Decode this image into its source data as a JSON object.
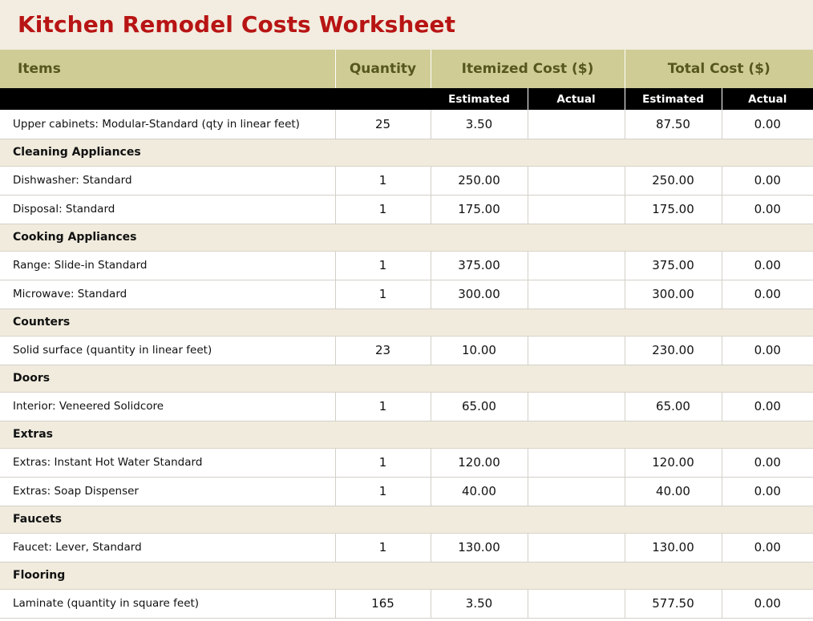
{
  "title": "Kitchen Remodel Costs Worksheet",
  "colors": {
    "title_text": "#b81414",
    "title_band": "#f2ede0",
    "group_header_bg": "#cfcd95",
    "group_header_text": "#56561f",
    "subheader_bg": "#000000",
    "subheader_text": "#ffffff",
    "category_row_bg": "#f0ebdd",
    "row_bg": "#ffffff",
    "grid_line": "#d4d0c8"
  },
  "header": {
    "items": "Items",
    "quantity": "Quantity",
    "itemized_cost": "Itemized Cost ($)",
    "total_cost": "Total Cost ($)"
  },
  "subheader": {
    "blank_items": "",
    "blank_quantity": "",
    "itemized_estimated": "Estimated",
    "itemized_actual": "Actual",
    "total_estimated": "Estimated",
    "total_actual": "Actual"
  },
  "rows": [
    {
      "kind": "item",
      "item": "Upper cabinets: Modular-Standard (qty in linear feet)",
      "quantity": "25",
      "itemized_estimated": "3.50",
      "itemized_actual": "",
      "total_estimated": "87.50",
      "total_actual": "0.00"
    },
    {
      "kind": "category",
      "item": "Cleaning Appliances"
    },
    {
      "kind": "item",
      "item": "Dishwasher: Standard",
      "quantity": "1",
      "itemized_estimated": "250.00",
      "itemized_actual": "",
      "total_estimated": "250.00",
      "total_actual": "0.00"
    },
    {
      "kind": "item",
      "item": "Disposal: Standard",
      "quantity": "1",
      "itemized_estimated": "175.00",
      "itemized_actual": "",
      "total_estimated": "175.00",
      "total_actual": "0.00"
    },
    {
      "kind": "category",
      "item": "Cooking Appliances"
    },
    {
      "kind": "item",
      "item": "Range: Slide-in Standard",
      "quantity": "1",
      "itemized_estimated": "375.00",
      "itemized_actual": "",
      "total_estimated": "375.00",
      "total_actual": "0.00"
    },
    {
      "kind": "item",
      "item": "Microwave: Standard",
      "quantity": "1",
      "itemized_estimated": "300.00",
      "itemized_actual": "",
      "total_estimated": "300.00",
      "total_actual": "0.00"
    },
    {
      "kind": "category",
      "item": "Counters"
    },
    {
      "kind": "item",
      "item": "Solid surface (quantity in linear feet)",
      "quantity": "23",
      "itemized_estimated": "10.00",
      "itemized_actual": "",
      "total_estimated": "230.00",
      "total_actual": "0.00"
    },
    {
      "kind": "category",
      "item": "Doors"
    },
    {
      "kind": "item",
      "item": "Interior: Veneered Solidcore",
      "quantity": "1",
      "itemized_estimated": "65.00",
      "itemized_actual": "",
      "total_estimated": "65.00",
      "total_actual": "0.00"
    },
    {
      "kind": "category",
      "item": "Extras"
    },
    {
      "kind": "item",
      "item": "Extras: Instant Hot Water Standard",
      "quantity": "1",
      "itemized_estimated": "120.00",
      "itemized_actual": "",
      "total_estimated": "120.00",
      "total_actual": "0.00"
    },
    {
      "kind": "item",
      "item": "Extras: Soap Dispenser",
      "quantity": "1",
      "itemized_estimated": "40.00",
      "itemized_actual": "",
      "total_estimated": "40.00",
      "total_actual": "0.00"
    },
    {
      "kind": "category",
      "item": "Faucets"
    },
    {
      "kind": "item",
      "item": "Faucet: Lever, Standard",
      "quantity": "1",
      "itemized_estimated": "130.00",
      "itemized_actual": "",
      "total_estimated": "130.00",
      "total_actual": "0.00"
    },
    {
      "kind": "category",
      "item": "Flooring"
    },
    {
      "kind": "item",
      "item": "Laminate (quantity in square feet)",
      "quantity": "165",
      "itemized_estimated": "3.50",
      "itemized_actual": "",
      "total_estimated": "577.50",
      "total_actual": "0.00"
    }
  ]
}
